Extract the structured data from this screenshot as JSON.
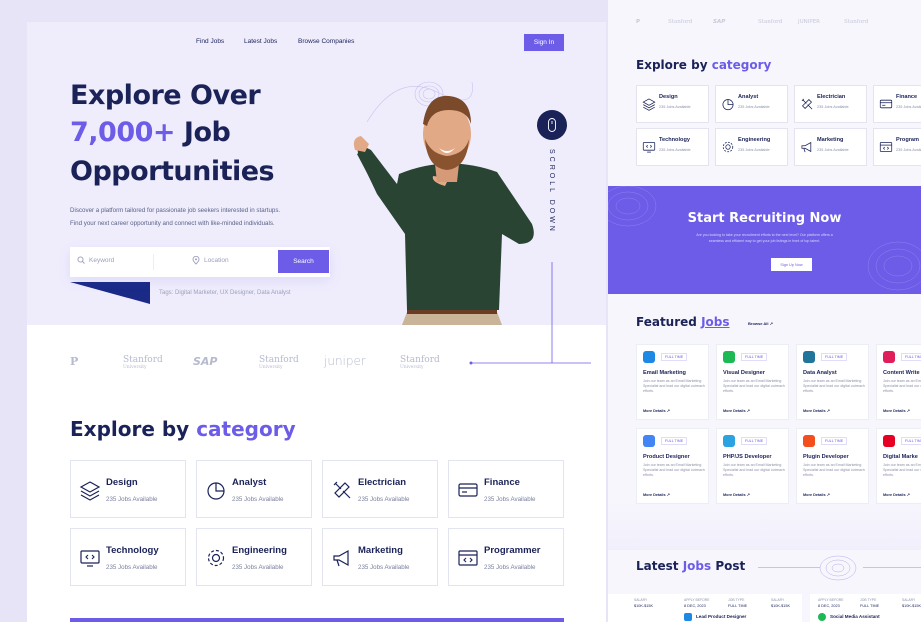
{
  "nav": {
    "items": [
      "Find Jobs",
      "Latest Jobs",
      "Browse Companies"
    ],
    "signin": "Sign In"
  },
  "hero": {
    "line1": "Explore Over",
    "line2_accent": "7,000+",
    "line2_rest": " Job",
    "line3": "Opportunities",
    "desc1": "Discover a platform tailored for passionate job seekers interested in startups.",
    "desc2": "Find your next career opportunity and connect with like-minded individuals.",
    "keyword_placeholder": "Keyword",
    "location_placeholder": "Location",
    "search_label": "Search",
    "tags": "Tags: Digital Marketer, UX Designer, Data Analyst",
    "scroll_label": "SCROLL DOWN"
  },
  "logos": [
    "Stanford",
    "SAP",
    "Stanford",
    "juniper",
    "Stanford"
  ],
  "logo_sub": "University",
  "explore": {
    "title": "Explore by",
    "accent": "category",
    "categories": [
      {
        "name": "Design",
        "count": "235 Jobs Available",
        "icon": "layers-icon"
      },
      {
        "name": "Analyst",
        "count": "235 Jobs Available",
        "icon": "pie-chart-icon"
      },
      {
        "name": "Electrician",
        "count": "235 Jobs Available",
        "icon": "tools-icon"
      },
      {
        "name": "Finance",
        "count": "235 Jobs Available",
        "icon": "card-icon"
      },
      {
        "name": "Technology",
        "count": "235 Jobs Available",
        "icon": "monitor-code-icon"
      },
      {
        "name": "Engineering",
        "count": "235 Jobs Available",
        "icon": "gear-icon"
      },
      {
        "name": "Marketing",
        "count": "235 Jobs Available",
        "icon": "megaphone-icon"
      },
      {
        "name": "Programmer",
        "count": "235 Jobs Available",
        "icon": "code-window-icon"
      }
    ]
  },
  "right": {
    "logos": [
      "Stanford",
      "SAP",
      "Stanford",
      "JUNIPER",
      "Stanford"
    ],
    "explore_title": "Explore by",
    "explore_accent": "category",
    "categories": [
      {
        "name": "Design",
        "count": "235 Jobs Available"
      },
      {
        "name": "Analyst",
        "count": "235 Jobs Available"
      },
      {
        "name": "Electrician",
        "count": "235 Jobs Available"
      },
      {
        "name": "Finance",
        "count": "235 Jobs Available"
      },
      {
        "name": "Technology",
        "count": "235 Jobs Available"
      },
      {
        "name": "Engineering",
        "count": "235 Jobs Available"
      },
      {
        "name": "Marketing",
        "count": "235 Jobs Available"
      },
      {
        "name": "Program",
        "count": "235 Jobs Available"
      }
    ],
    "recruit_title": "Start Recruiting Now",
    "recruit_desc1": "Are you looking to take your recruitment efforts to the next level? Our platform offers a",
    "recruit_desc2": "seamless and efficient way to get your job listings in front of top talent.",
    "recruit_button": "Sign Up Now",
    "featured_title": "Featured",
    "featured_accent": "Jobs",
    "browse_all": "Browse All",
    "job_type": "FULL TIME",
    "job_desc": "Join our team as an Email Marketing Specialist and lead our digital outreach efforts.",
    "more_details": "More Details",
    "jobs": [
      {
        "title": "Email Marketing",
        "logo_color": "#1e88e5"
      },
      {
        "title": "Visual Designer",
        "logo_color": "#1db954"
      },
      {
        "title": "Data Analyst",
        "logo_color": "#21759b"
      },
      {
        "title": "Content Write",
        "logo_color": "#e01e5a"
      },
      {
        "title": "Product Designer",
        "logo_color": "#4285f4"
      },
      {
        "title": "PHP/JS Developer",
        "logo_color": "#2aa3e0"
      },
      {
        "title": "Plugin Developer",
        "logo_color": "#f24e1e"
      },
      {
        "title": "Digital Marke",
        "logo_color": "#e60023"
      }
    ],
    "latest_title": "Latest",
    "latest_accent": "Jobs",
    "latest_rest": " Post",
    "latest_strip": [
      "APPLY BEFORE",
      "JOB TYPE",
      "SALARY",
      "8 DEC, 2023",
      "FULL TIME",
      "$10K-$15K"
    ],
    "latest_job": "Lead Product Designer",
    "latest_job2": "Social Media Assistant"
  }
}
